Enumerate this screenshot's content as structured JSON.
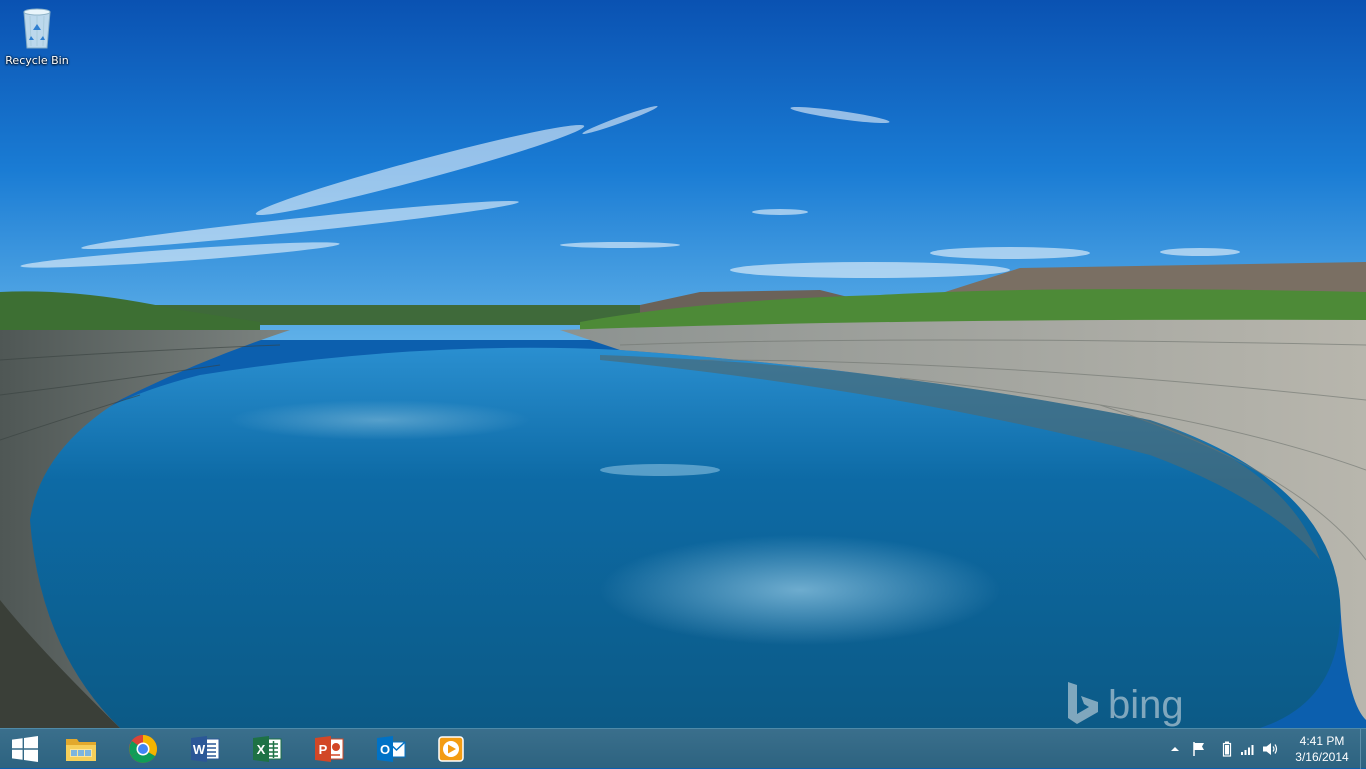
{
  "desktop": {
    "icons": [
      {
        "label": "Recycle Bin",
        "icon": "recycle-bin-icon"
      }
    ],
    "watermark": {
      "text": "bing",
      "icon": "bing-logo-icon"
    }
  },
  "taskbar": {
    "start": {
      "icon": "windows-logo-icon"
    },
    "pinned": [
      {
        "name": "File Explorer",
        "icon": "file-explorer-icon",
        "color": "#f5c242"
      },
      {
        "name": "Google Chrome",
        "icon": "chrome-icon",
        "color": "#db4437"
      },
      {
        "name": "Word",
        "icon": "word-icon",
        "color": "#2b5797"
      },
      {
        "name": "Excel",
        "icon": "excel-icon",
        "color": "#1e7145"
      },
      {
        "name": "PowerPoint",
        "icon": "powerpoint-icon",
        "color": "#d24726"
      },
      {
        "name": "Outlook",
        "icon": "outlook-icon",
        "color": "#0072c6"
      },
      {
        "name": "Media Player",
        "icon": "media-player-icon",
        "color": "#f39c12"
      }
    ],
    "tray": {
      "icons": [
        "show-hidden-icons-chevron",
        "action-center-flag-icon",
        "battery-icon",
        "network-signal-icon",
        "volume-icon"
      ],
      "time": "4:41 PM",
      "date": "3/16/2014"
    }
  }
}
